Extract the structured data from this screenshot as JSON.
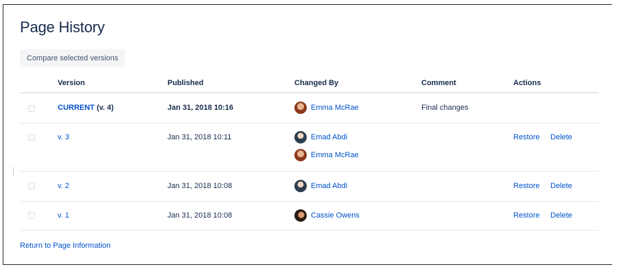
{
  "page": {
    "title": "Page History",
    "compare_button": "Compare selected versions",
    "return_link": "Return to Page Information"
  },
  "table": {
    "headers": {
      "version": "Version",
      "published": "Published",
      "changed_by": "Changed By",
      "comment": "Comment",
      "actions": "Actions"
    },
    "rows": [
      {
        "version_link": "CURRENT",
        "version_suffix": "(v. 4)",
        "published": "Jan 31, 2018 10:16",
        "users": [
          "Emma McRae"
        ],
        "comment": "Final changes",
        "restore": "",
        "delete": ""
      },
      {
        "version_link": "v. 3",
        "published": "Jan 31, 2018 10:11",
        "users": [
          "Emad Abdi",
          "Emma McRae"
        ],
        "comment": "",
        "restore": "Restore",
        "delete": "Delete"
      },
      {
        "version_link": "v. 2",
        "published": "Jan 31, 2018 10:08",
        "users": [
          "Emad Abdi"
        ],
        "comment": "",
        "restore": "Restore",
        "delete": "Delete"
      },
      {
        "version_link": "v. 1",
        "published": "Jan 31, 2018 10:08",
        "users": [
          "Cassie Owens"
        ],
        "comment": "",
        "restore": "Restore",
        "delete": "Delete"
      }
    ]
  },
  "colors": {
    "link": "#0052cc",
    "text": "#172b4d",
    "border": "#e4e6ea",
    "button_bg": "#f4f5f7"
  }
}
